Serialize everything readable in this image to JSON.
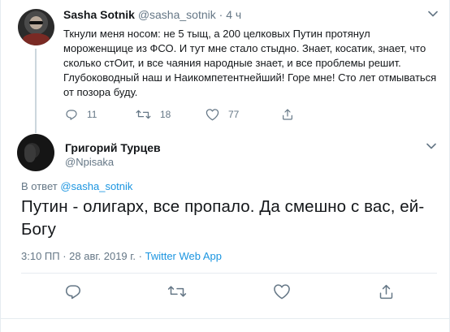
{
  "parent_tweet": {
    "author_name": "Sasha Sotnik",
    "handle": "@sasha_sotnik",
    "separator": "·",
    "time": "4 ч",
    "text": "Ткнули меня носом: не 5 тыщ, а 200 целковых Путин протянул мороженщице из ФСО. И тут мне стало стыдно. Знает, косатик, знает, что сколько стОит, и все чаяния народные знает, и все проблемы решит. Глубоководный наш и Наикомпетентнейший! Горе мне! Сто лет отмываться от позора буду.",
    "reply_count": "11",
    "retweet_count": "18",
    "like_count": "77"
  },
  "focused_tweet": {
    "author_name": "Григорий Турцев",
    "handle": "@Npisaka",
    "reply_prefix": "В ответ",
    "reply_to": "@sasha_sotnik",
    "text": "Путин - олигарх, все пропало. Да смешно с вас, ей-Богу",
    "timestamp": "3:10 ПП · 28 авг. 2019 г. · ",
    "source_app": "Twitter Web App"
  },
  "icons": {
    "reply": "reply-icon",
    "retweet": "retweet-icon",
    "like": "heart-icon",
    "share": "share-icon",
    "more": "chevron-down-icon"
  },
  "colors": {
    "text_primary": "#14171a",
    "text_secondary": "#657786",
    "link": "#1b95e0",
    "divider": "#e6ecf0",
    "thread_line": "#ccd6dd"
  }
}
